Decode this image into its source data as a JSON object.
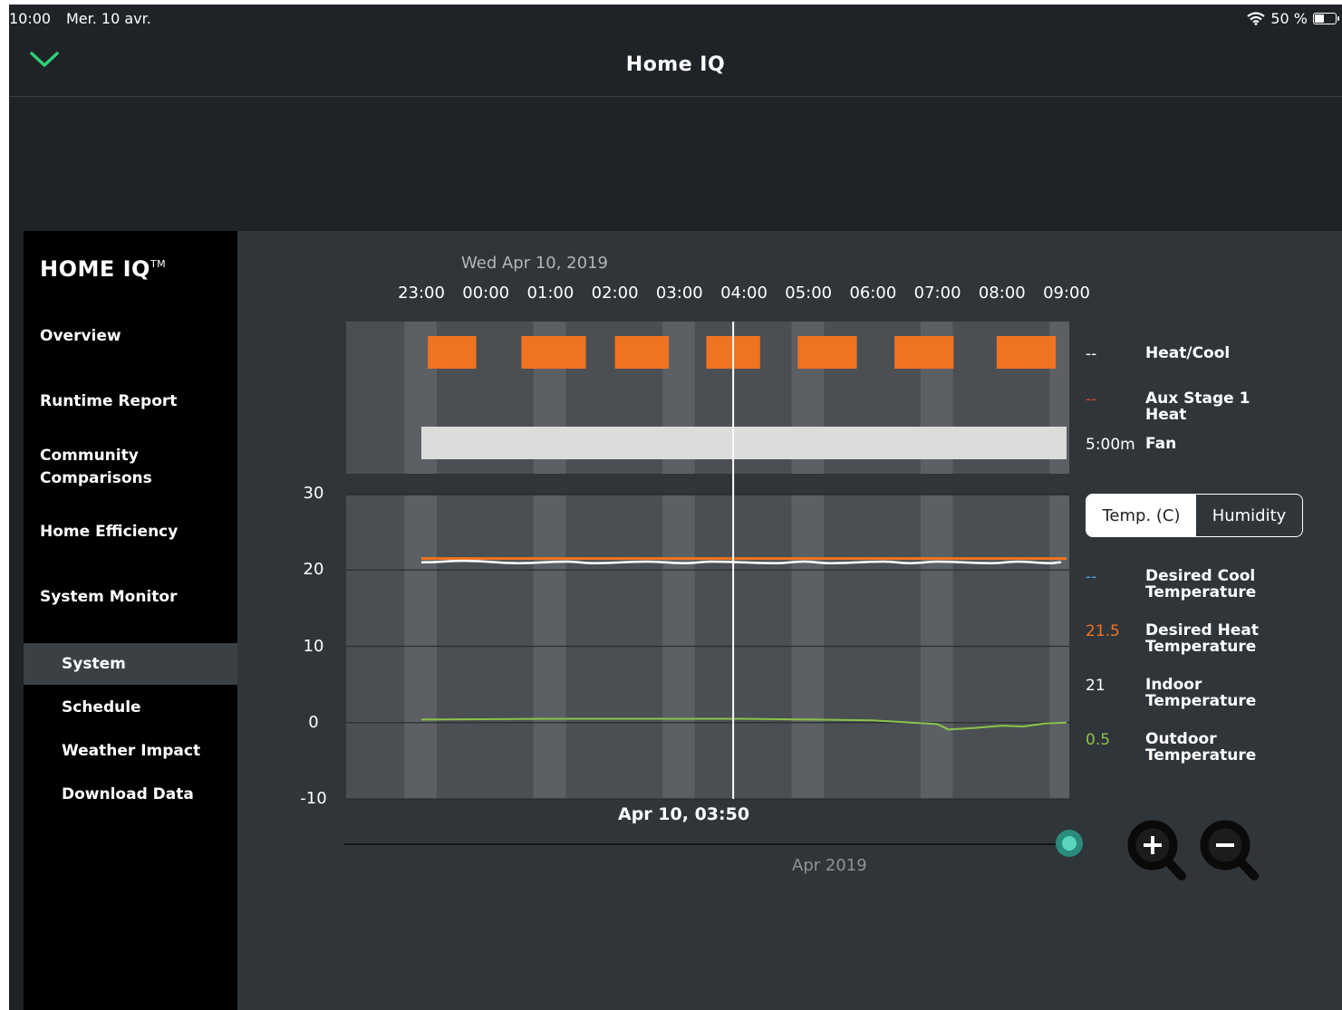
{
  "status_bar": {
    "time": "10:00",
    "date": "Mer. 10 avr.",
    "battery": "50 %"
  },
  "header": {
    "title": "Home IQ"
  },
  "sidebar": {
    "brand": "HOME IQ",
    "brand_tm": "TM",
    "items": [
      {
        "label": "Overview"
      },
      {
        "label": "Runtime Report"
      },
      {
        "label": "Community\nComparisons"
      },
      {
        "label": "Home Efficiency"
      },
      {
        "label": "System Monitor"
      }
    ],
    "sub_items": [
      {
        "label": "System",
        "active": true
      },
      {
        "label": "Schedule",
        "active": false
      },
      {
        "label": "Weather Impact",
        "active": false
      },
      {
        "label": "Download Data",
        "active": false
      }
    ]
  },
  "chart_data": {
    "type": "line",
    "date_title": "Wed Apr 10, 2019",
    "x_ticks": [
      "23:00",
      "00:00",
      "01:00",
      "02:00",
      "03:00",
      "04:00",
      "05:00",
      "06:00",
      "07:00",
      "08:00",
      "09:00"
    ],
    "y_ticks": [
      "30",
      "20",
      "10",
      "0",
      "-10"
    ],
    "ylim": [
      -10,
      30
    ],
    "runtime_rows": [
      {
        "name": "Heat/Cool",
        "value": "--",
        "value_color": "#ffffff",
        "segments": [
          [
            "23:06",
            "23:51"
          ],
          [
            "00:33",
            "01:33"
          ],
          [
            "02:00",
            "02:50"
          ],
          [
            "03:25",
            "04:15"
          ],
          [
            "04:50",
            "05:45"
          ],
          [
            "06:20",
            "07:15"
          ],
          [
            "07:55",
            "08:50"
          ]
        ],
        "color": "#f07321"
      },
      {
        "name": "Aux Stage 1 Heat",
        "value": "--",
        "value_color": "#e0433b",
        "segments": []
      },
      {
        "name": "Fan",
        "value": "5:00m",
        "value_color": "#ffffff",
        "segments": [
          [
            "23:00",
            "09:00"
          ]
        ],
        "color": "#dcdcdc"
      }
    ],
    "series": [
      {
        "name": "Desired Cool Temperature",
        "value": "--",
        "color": "#4aa3df",
        "x": [],
        "y": []
      },
      {
        "name": "Desired Heat Temperature",
        "value": "21.5",
        "color": "#f07321",
        "x": [
          "23:00",
          "09:00"
        ],
        "y": [
          21.5,
          21.5
        ]
      },
      {
        "name": "Indoor Temperature",
        "value": "21",
        "color": "#ffffff",
        "x": [
          "23:00",
          "23:40",
          "00:30",
          "01:15",
          "01:40",
          "02:30",
          "03:05",
          "03:30",
          "04:30",
          "04:55",
          "05:20",
          "06:10",
          "06:35",
          "07:00",
          "07:50",
          "08:15",
          "08:45",
          "08:55"
        ],
        "y": [
          21,
          21.2,
          20.9,
          21.1,
          20.9,
          21.1,
          20.9,
          21.1,
          20.9,
          21.1,
          20.9,
          21.1,
          20.9,
          21.1,
          20.9,
          21.1,
          20.9,
          21
        ]
      },
      {
        "name": "Outdoor Temperature",
        "value": "0.5",
        "color": "#8bc34a",
        "x": [
          "23:00",
          "01:00",
          "04:00",
          "06:00",
          "07:00",
          "07:10",
          "07:35",
          "08:00",
          "08:20",
          "08:40",
          "09:00"
        ],
        "y": [
          0.4,
          0.5,
          0.5,
          0.3,
          -0.2,
          -0.9,
          -0.7,
          -0.4,
          -0.5,
          -0.1,
          0
        ]
      }
    ],
    "cursor": {
      "label": "Apr 10, 03:50",
      "time": "03:50"
    },
    "toggle": {
      "selected": "Temp. (C)",
      "other": "Humidity"
    },
    "timeline_label": "Apr 2019",
    "grid": true
  },
  "colors": {
    "accent_green": "#2fd07a",
    "teal": "#59d6bd"
  }
}
